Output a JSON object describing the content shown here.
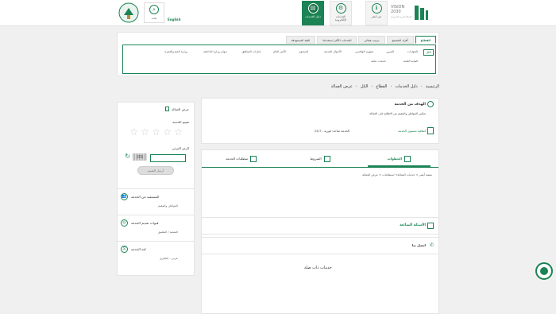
{
  "header": {
    "brand_name": "Absher",
    "vision_text": "VISION 2030",
    "vision_sub": "المملكة العربية السعودية",
    "nav": [
      {
        "label": "عن أبشر",
        "icon": "info-icon"
      },
      {
        "label": "الخدمات الإلكترونية",
        "icon": "services-icon"
      },
      {
        "label": "دليل الخدمات",
        "icon": "guide-icon"
      }
    ],
    "search_label": "بحث",
    "login_label": "English"
  },
  "sector": {
    "tabs": [
      "القطاع",
      "أفراد المجتمع",
      "ترتيب هجائي",
      "الخدمات الأكثر استخداما",
      "الفئة المستهدفة"
    ],
    "categories": [
      "الكل",
      "الجوازات",
      "المرور",
      "شؤون الوافدين",
      "الأحوال المدنية",
      "السجون",
      "الأمن العام",
      "إمارات المناطق",
      "ديوان وزارة الداخلية",
      "وزارة الحج والعمرة",
      "النيابة العامة",
      "خدمات عامة"
    ]
  },
  "breadcrumb": [
    "الرئيسية",
    "دليل الخدمات",
    "القطاع",
    "الكل",
    "عرض العمالة"
  ],
  "rating": {
    "title": "عرض العمالة",
    "rate_label": "تقييم الخدمة",
    "captcha_label": "الرمز المرئي",
    "captcha_text": "3TB",
    "submit_label": "أرسل التقييم",
    "beneficiaries_title": "المستفيد من الخدمة",
    "beneficiaries_value": "المواطن والمقيم",
    "channels_title": "قنوات تقديم الخدمة",
    "channels_value": "المنصة / التطبيق",
    "language_title": "لغة الخدمة",
    "language_value": "عربي - انجليزي"
  },
  "service": {
    "goal_title": "الهدف من الخدمة",
    "goal_text": "تمكين المواطن والمقيم من الاطلاع على العمالة.",
    "sla_label": "اتفاقية مستوى الخدمة",
    "availability": "الخدمة متاحة: فورية - 24/7",
    "tabs": [
      "الخطوات",
      "الشروط",
      "متطلبات الخدمة"
    ],
    "steps": "منصة أبشر > خدمات العمالة> استعلامات > عرض العمالة",
    "faq": "الأسئلة الشائعة",
    "howto": "اتصل بنا",
    "related": "خدمات ذات صلة"
  }
}
